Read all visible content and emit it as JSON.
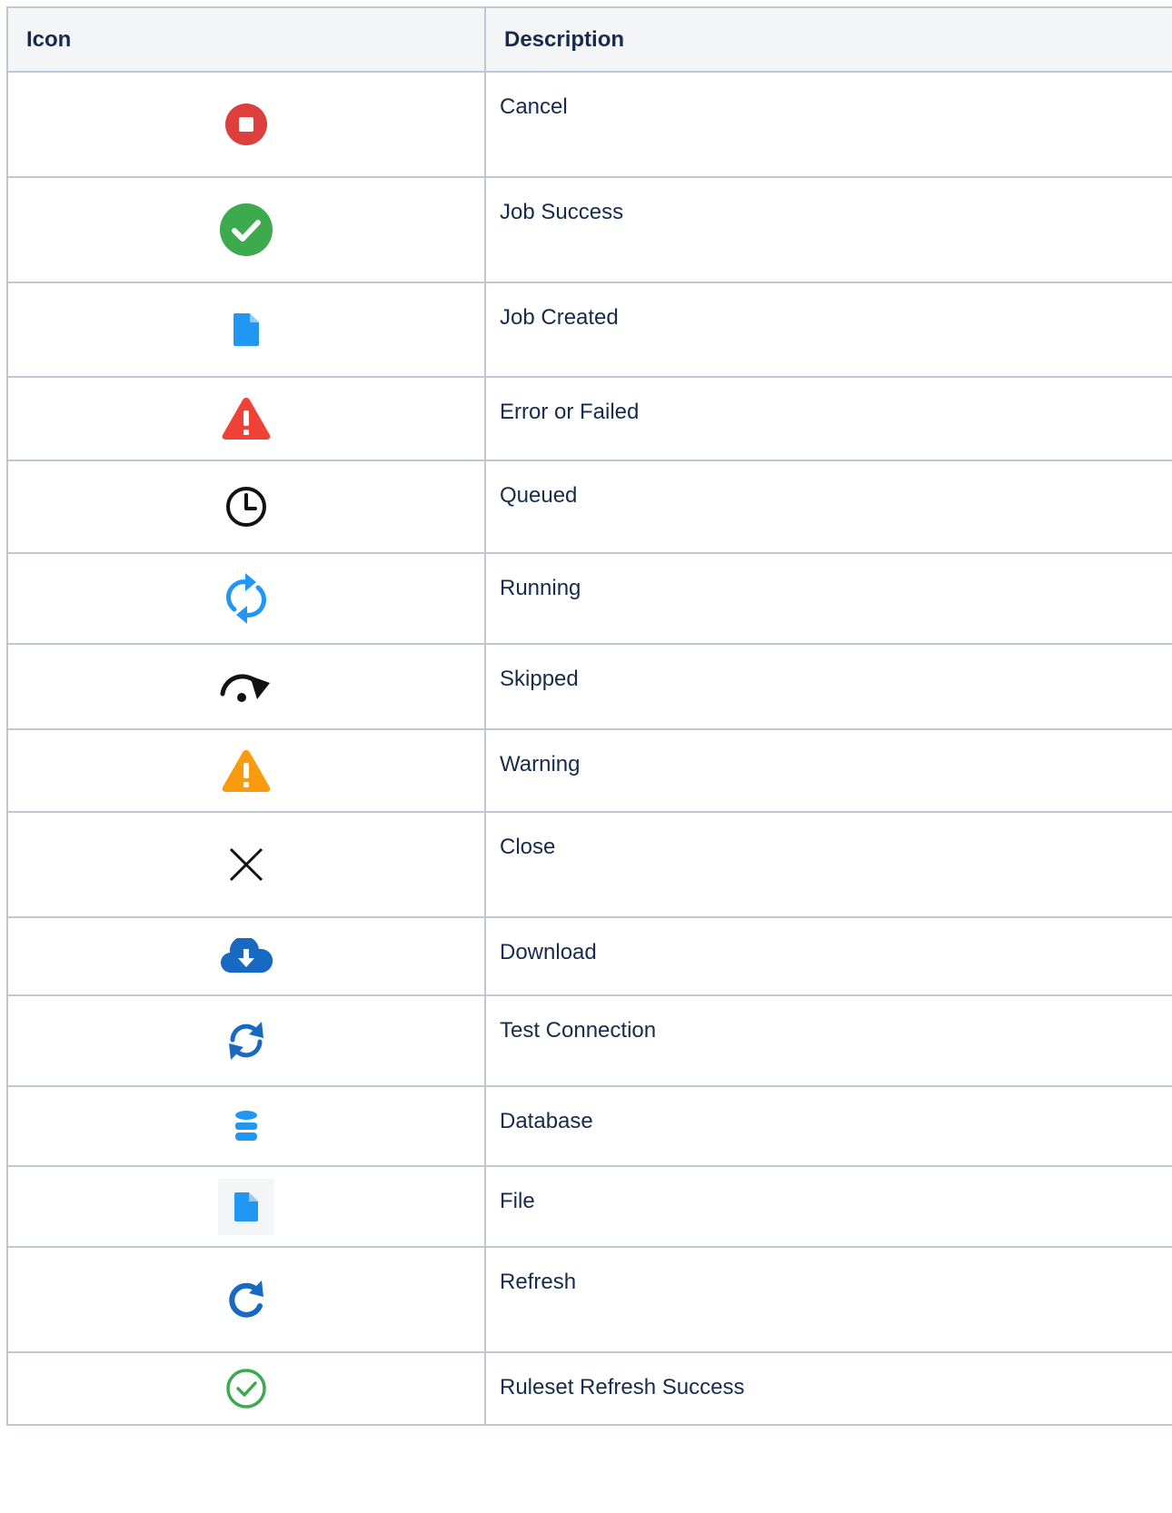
{
  "header": {
    "icon": "Icon",
    "description": "Description"
  },
  "rows": [
    {
      "icon": "cancel-icon",
      "label": "Cancel"
    },
    {
      "icon": "job-success-icon",
      "label": "Job Success"
    },
    {
      "icon": "job-created-icon",
      "label": "Job Created"
    },
    {
      "icon": "error-icon",
      "label": "Error or Failed"
    },
    {
      "icon": "queued-icon",
      "label": "Queued"
    },
    {
      "icon": "running-icon",
      "label": "Running"
    },
    {
      "icon": "skipped-icon",
      "label": "Skipped"
    },
    {
      "icon": "warning-icon",
      "label": "Warning"
    },
    {
      "icon": "close-icon",
      "label": "Close"
    },
    {
      "icon": "download-icon",
      "label": "Download"
    },
    {
      "icon": "test-connection-icon",
      "label": "Test Connection"
    },
    {
      "icon": "database-icon",
      "label": "Database"
    },
    {
      "icon": "file-icon",
      "label": "File"
    },
    {
      "icon": "refresh-icon",
      "label": "Refresh"
    },
    {
      "icon": "ruleset-refresh-success-icon",
      "label": "Ruleset Refresh Success"
    }
  ],
  "colors": {
    "header_bg": "#f4f5f7",
    "border": "#c1c7d0",
    "text": "#172b4d",
    "cancel": "#dc3f3c",
    "success": "#3daa4e",
    "blue": "#2196f3",
    "dark_blue": "#1769c2",
    "error": "#ef4136",
    "warning": "#f99a0f"
  }
}
